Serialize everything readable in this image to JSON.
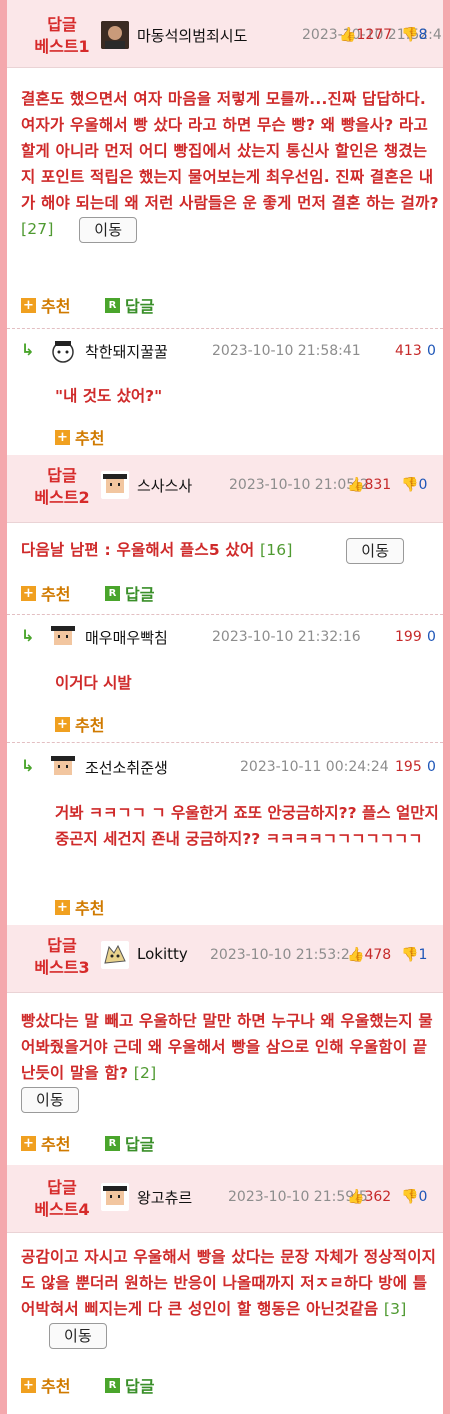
{
  "comments": [
    {
      "badge": [
        "답글",
        "베스트1"
      ],
      "nick": "마동석의범죄시도",
      "date": "2023-10-10 21:52:4",
      "up": "1277",
      "down": "8",
      "text": "결혼도 했으면서 여자 마음을 저렇게 모를까...진짜 답답하다. 여자가 우울해서 빵 샀다 라고 하면 무슨 빵? 왜 빵을사? 라고 할게 아니라 먼저 어디 빵집에서 샀는지 통신사 할인은 챙겼는지 포인트 적립은 했는지 물어보는게 최우선임. 진짜 결혼은 내가 해야 되는데 왜 저런 사람들은 운 좋게 먼저 결혼 하는 걸까?",
      "reply_count": "[27]",
      "move": "이동",
      "recommend": "추천",
      "reply": "답글"
    },
    {
      "badge": [
        "답글",
        "베스트2"
      ],
      "nick": "스사스사",
      "date": "2023-10-10 21:05:2",
      "up": "831",
      "down": "0",
      "text": "다음날 남편 : 우울해서 플스5 샀어",
      "reply_count": "[16]",
      "move": "이동",
      "recommend": "추천",
      "reply": "답글"
    },
    {
      "badge": [
        "답글",
        "베스트3"
      ],
      "nick": "Lokitty",
      "date": "2023-10-10 21:53:2",
      "up": "478",
      "down": "1",
      "text": "빵샀다는 말 빼고 우울하단 말만 하면 누구나 왜 우울했는지 물어봐줬을거야 근데 왜 우울해서 빵을 삼으로 인해 우울함이 끝난듯이 말을 함?",
      "reply_count": "[2]",
      "move": "이동",
      "recommend": "추천",
      "reply": "답글"
    },
    {
      "badge": [
        "답글",
        "베스트4"
      ],
      "nick": "왕고츄르",
      "date": "2023-10-10 21:59:5",
      "up": "362",
      "down": "0",
      "text": "공감이고 자시고 우울해서 빵을 샀다는 문장 자체가 정상적이지도 않을 뿐더러 원하는 반응이 나올때까지 저ㅈㄹ하다 방에 틀어박혀서 삐지는게 다 큰 성인이 할 행동은 아닌것같음",
      "reply_count": "[3]",
      "move": "이동",
      "recommend": "추천",
      "reply": "답글"
    }
  ],
  "replies": [
    {
      "nick": "착한돼지꿀꿀",
      "date": "2023-10-10 21:58:41",
      "up": "413",
      "down": "0",
      "text": "\"내 것도 샀어?\"",
      "recommend": "추천"
    },
    {
      "nick": "매우매우빡침",
      "date": "2023-10-10 21:32:16",
      "up": "199",
      "down": "0",
      "text": "이거다 시발",
      "recommend": "추천"
    },
    {
      "nick": "조선소취준생",
      "date": "2023-10-11 00:24:24",
      "up": "195",
      "down": "0",
      "text": "거봐 ㅋㅋㄱㄱ ㄱ 우울한거 죠또 안궁금하지?? 플스 얼만지 중곤지 세건지 죤내 궁금하지?? ㅋㅋㅋㅋㄱㄱㄱㄱㄱㄱㄱ",
      "recommend": "추천"
    }
  ],
  "icons": {
    "thumb_up": "thumbs-up-icon",
    "thumb_down": "thumbs-down-icon",
    "reply_arrow": "reply-arrow-icon",
    "plus": "plus-icon",
    "r_badge": "r-badge-icon"
  },
  "colors": {
    "accent_red": "#cf2a2a",
    "reply_green": "#4aa52c",
    "recommend_orange": "#d07a00",
    "best_header_bg": "#fbe7e9",
    "frame_pink": "#f4a8ad"
  }
}
